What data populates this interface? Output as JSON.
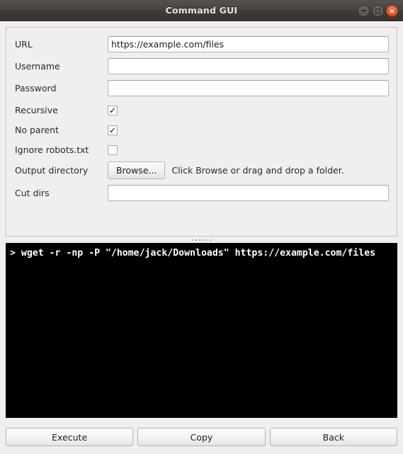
{
  "window": {
    "title": "Command GUI",
    "buttons": {
      "minimize": "minimize",
      "maximize": "maximize",
      "close": "×"
    }
  },
  "form": {
    "fields": [
      {
        "label": "URL",
        "type": "text",
        "value": "https://example.com/files",
        "placeholder": ""
      },
      {
        "label": "Username",
        "type": "text",
        "value": "",
        "placeholder": ""
      },
      {
        "label": "Password",
        "type": "text",
        "value": "",
        "placeholder": ""
      },
      {
        "label": "Recursive",
        "type": "checkbox",
        "checked": true,
        "mark": "✓"
      },
      {
        "label": "No parent",
        "type": "checkbox",
        "checked": true,
        "mark": "✓"
      },
      {
        "label": "Ignore robots.txt",
        "type": "checkbox",
        "checked": false,
        "mark": ""
      },
      {
        "label": "Output directory",
        "type": "browse",
        "button_label": "Browse...",
        "hint": "Click Browse or drag and drop a folder."
      },
      {
        "label": "Cut dirs",
        "type": "text",
        "value": "",
        "placeholder": ""
      }
    ]
  },
  "terminal": {
    "command": "> wget -r -np -P \"/home/jack/Downloads\" https://example.com/files"
  },
  "actions": {
    "execute_label": "Execute",
    "copy_label": "Copy",
    "back_label": "Back"
  },
  "colors": {
    "titlebar": "#4a4542",
    "close_button": "#dd4814",
    "panel_background": "#f0efee",
    "terminal_background": "#000000",
    "terminal_text": "#ffffff"
  }
}
